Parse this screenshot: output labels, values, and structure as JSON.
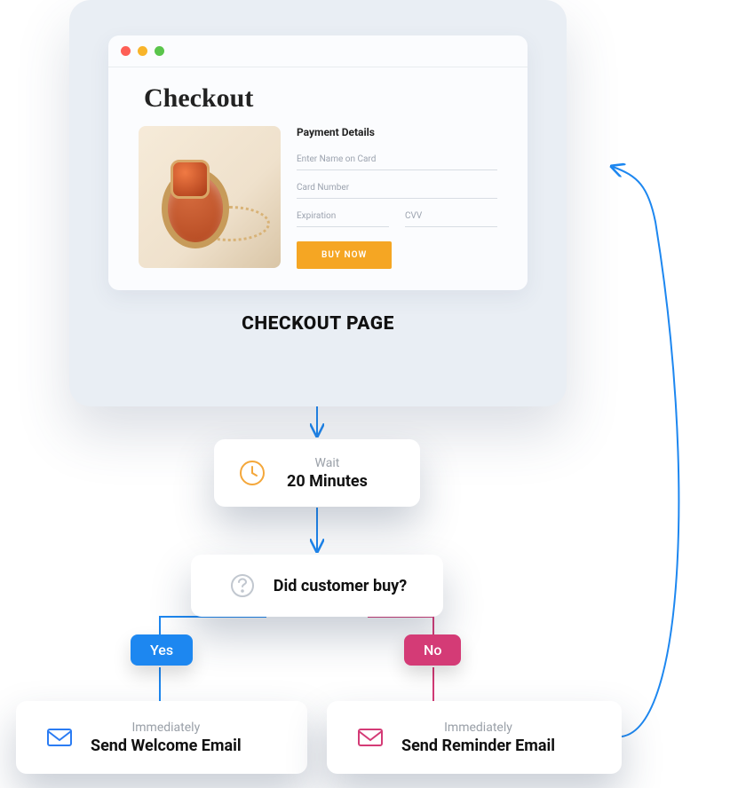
{
  "panel": {
    "checkout_title": "Checkout",
    "form_heading": "Payment Details",
    "fields": {
      "name": "Enter Name on Card",
      "card": "Card Number",
      "exp": "Expiration",
      "cvv": "CVV"
    },
    "buy_button": "BUY NOW",
    "panel_label": "CHECKOUT PAGE"
  },
  "flow": {
    "wait": {
      "sub": "Wait",
      "main": "20 Minutes"
    },
    "question": "Did customer buy?",
    "tag_yes": "Yes",
    "tag_no": "No",
    "yes_node": {
      "sub": "Immediately",
      "main": "Send Welcome Email"
    },
    "no_node": {
      "sub": "Immediately",
      "main": "Send Reminder Email"
    }
  },
  "colors": {
    "blue": "#1d87f0",
    "pink": "#d43b76",
    "orange": "#f5a623"
  }
}
